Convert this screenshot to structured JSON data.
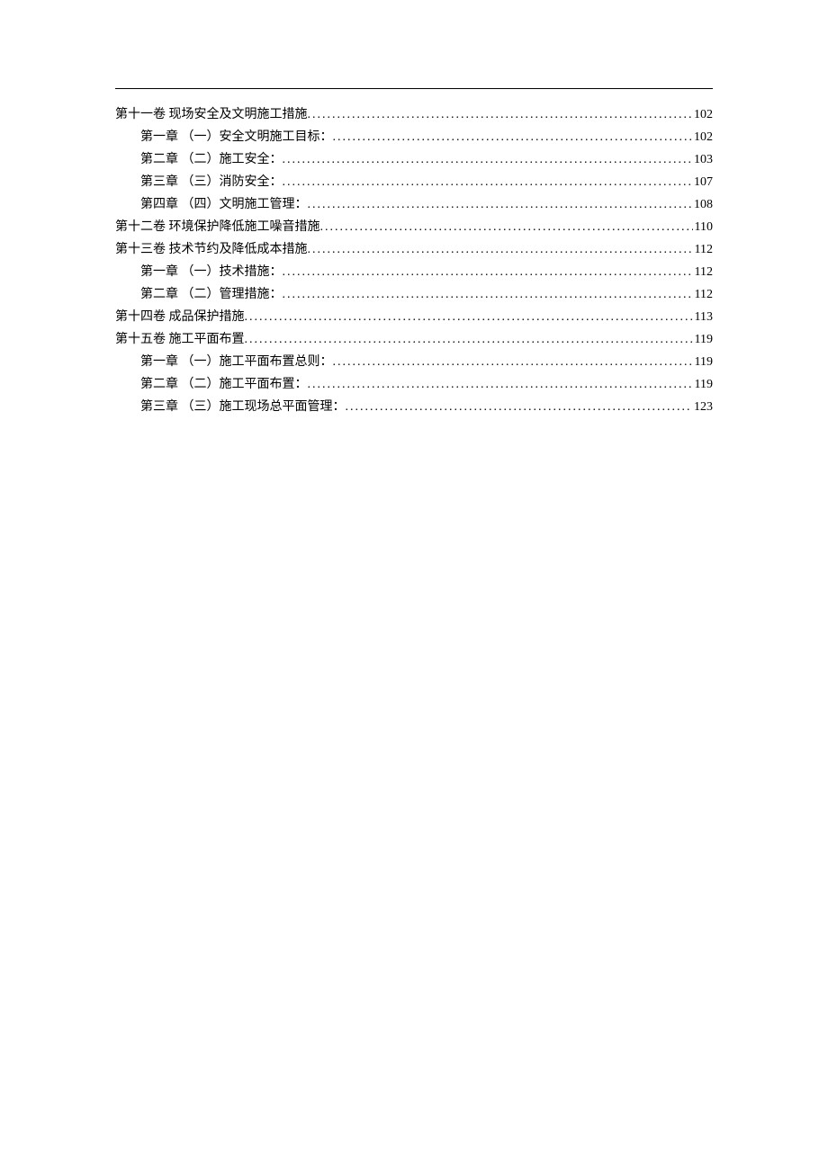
{
  "toc": [
    {
      "level": 1,
      "label": "第十一卷 现场安全及文明施工措施",
      "page": "102"
    },
    {
      "level": 2,
      "label": "第一章 （一）安全文明施工目标：",
      "page": "102"
    },
    {
      "level": 2,
      "label": "第二章 （二）施工安全：",
      "page": "103"
    },
    {
      "level": 2,
      "label": "第三章 （三）消防安全：",
      "page": "107"
    },
    {
      "level": 2,
      "label": "第四章 （四）文明施工管理：",
      "page": "108"
    },
    {
      "level": 1,
      "label": "第十二卷 环境保护降低施工噪音措施",
      "page": "110"
    },
    {
      "level": 1,
      "label": "第十三卷 技术节约及降低成本措施",
      "page": "112"
    },
    {
      "level": 2,
      "label": "第一章 （一）技术措施：",
      "page": "112"
    },
    {
      "level": 2,
      "label": "第二章 （二）管理措施：",
      "page": "112"
    },
    {
      "level": 1,
      "label": "第十四卷 成品保护措施",
      "page": "113"
    },
    {
      "level": 1,
      "label": "第十五卷 施工平面布置",
      "page": "119"
    },
    {
      "level": 2,
      "label": "第一章 （一）施工平面布置总则：",
      "page": "119"
    },
    {
      "level": 2,
      "label": "第二章 （二）施工平面布置：",
      "page": "119"
    },
    {
      "level": 2,
      "label": "第三章 （三）施工现场总平面管理：",
      "page": "123"
    }
  ]
}
